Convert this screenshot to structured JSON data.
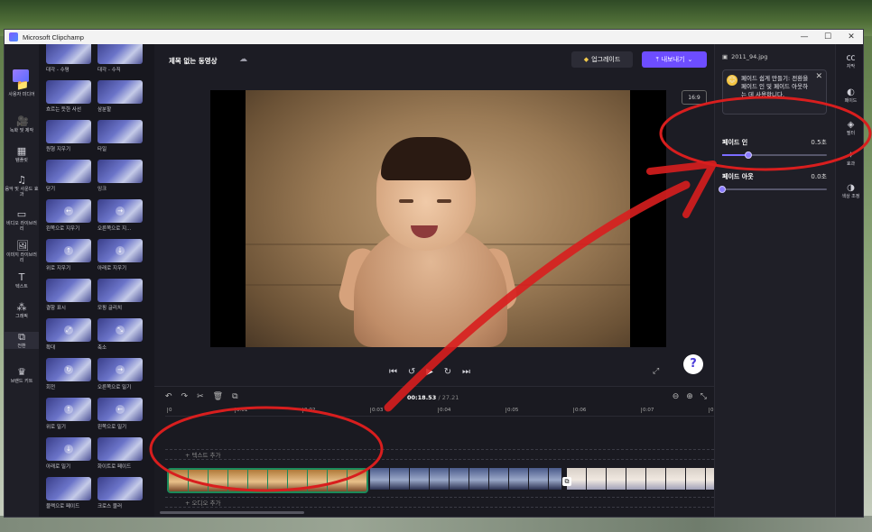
{
  "window": {
    "title": "Microsoft Clipchamp",
    "controls": [
      "—",
      "☐",
      "✕"
    ]
  },
  "leftnav": [
    {
      "label": "사용자 미디어",
      "icon": "📁"
    },
    {
      "label": "녹화 및 제작",
      "icon": "🎥"
    },
    {
      "label": "템플릿",
      "icon": "▦"
    },
    {
      "label": "음악 및 사운드 효과",
      "icon": "♫"
    },
    {
      "label": "비디오 라이브러리",
      "icon": "▭"
    },
    {
      "label": "이미지 라이브러리",
      "icon": "🖼"
    },
    {
      "label": "텍스트",
      "icon": "T"
    },
    {
      "label": "그래픽",
      "icon": "⁂"
    },
    {
      "label": "전환",
      "icon": "⧉"
    },
    {
      "label": "브랜드 키트",
      "icon": "♛"
    }
  ],
  "transitions": [
    "대각 - 수평",
    "대각 - 수직",
    "흐르는 듯한 사선",
    "삼분할",
    "원형 지우기",
    "타일",
    "닫기",
    "잉크",
    "왼쪽으로 지우기",
    "오른쪽으로 지...",
    "위로 지우기",
    "아래로 지우기",
    "결함 표시",
    "모핑 글리치",
    "확대",
    "축소",
    "회전",
    "오른쪽으로 밀기",
    "위로 밀기",
    "왼쪽으로 밀기",
    "아래로 밀기",
    "화이트로 페이드",
    "블랙으로 페이드",
    "크로스 블러"
  ],
  "transition_glyphs": [
    "",
    "",
    "",
    "",
    "",
    "",
    "",
    "",
    "←",
    "→",
    "↑",
    "↓",
    "",
    "",
    "⤢",
    "⤡",
    "↻",
    "→",
    "↑",
    "←",
    "↓",
    "",
    "",
    ""
  ],
  "header": {
    "project_title": "제목 없는 동영상",
    "upgrade_label": "업그레이드",
    "export_label": "내보내기",
    "aspect_ratio": "16:9"
  },
  "timeline": {
    "current_time": "00:18",
    "current_frac": ".53",
    "total_time": "/ 27.21",
    "ruler": [
      "0",
      "0:01",
      "0:02",
      "0:03",
      "0:04",
      "0:05",
      "0:06",
      "0:07",
      "0:08"
    ],
    "text_track": "+ 텍스트 추가",
    "audio_track": "+ 오디오 추가"
  },
  "properties": {
    "file_name": "2011_94.jpg",
    "tip_text": "페이드 쉽게 만들기: 전환을 페이드 인 및 페이드 아웃하는 데 사용합니다.",
    "fade_in": {
      "label": "페이드 인",
      "value": "0.5초",
      "level": 0.25
    },
    "fade_out": {
      "label": "페이드 아웃",
      "value": "0.0초",
      "level": 0.0
    }
  },
  "rightrail": [
    {
      "label": "자막",
      "icon": "㏄"
    },
    {
      "label": "페이드",
      "icon": "◐"
    },
    {
      "label": "필터",
      "icon": "◈"
    },
    {
      "label": "효과",
      "icon": "✧"
    },
    {
      "label": "색상 조정",
      "icon": "◑"
    }
  ],
  "colors": {
    "accent": "#6d4dff",
    "annotation": "#d81e1e",
    "clip_selected": "#1b8a5a"
  }
}
